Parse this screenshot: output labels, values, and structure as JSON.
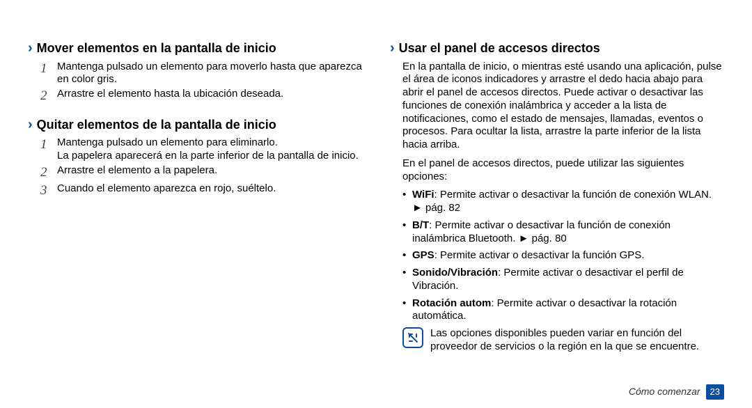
{
  "left": {
    "sec1": {
      "title": "Mover elementos en la pantalla de inicio",
      "steps": [
        "Mantenga pulsado un elemento para moverlo hasta que aparezca en color gris.",
        "Arrastre el elemento hasta la ubicación deseada."
      ]
    },
    "sec2": {
      "title": "Quitar elementos de la pantalla de inicio",
      "step1": "Mantenga pulsado un elemento para eliminarlo.",
      "step1b": "La papelera aparecerá en la parte inferior de la pantalla de inicio.",
      "step2": "Arrastre el elemento a la papelera.",
      "step3": "Cuando el elemento aparezca en rojo, suéltelo."
    }
  },
  "right": {
    "sec": {
      "title": "Usar el panel de accesos directos",
      "para1": "En la pantalla de inicio, o mientras esté usando una aplicación, pulse el área de iconos indicadores y arrastre el dedo hacia abajo para abrir el panel de accesos directos. Puede activar o desactivar las funciones de conexión inalámbrica y acceder a la lista de notificaciones, como el estado de mensajes, llamadas, eventos o procesos. Para ocultar la lista, arrastre la parte inferior de la lista hacia arriba.",
      "para2": "En el panel de accesos directos, puede utilizar las siguientes opciones:",
      "bullets": [
        {
          "bold": "WiFi",
          "rest": ": Permite activar o desactivar la función de conexión WLAN. ",
          "arrow": "►",
          "ref": " pág. 82"
        },
        {
          "bold": "B/T",
          "rest": ": Permite activar o desactivar la función de conexión inalámbrica Bluetooth. ",
          "arrow": "►",
          "ref": " pág. 80"
        },
        {
          "bold": "GPS",
          "rest": ": Permite activar o desactivar la función GPS.",
          "arrow": "",
          "ref": ""
        },
        {
          "bold": "Sonido/Vibración",
          "rest": ": Permite activar o desactivar el perfil de Vibración.",
          "arrow": "",
          "ref": ""
        },
        {
          "bold": "Rotación autom",
          "rest": ": Permite activar o desactivar la rotación automática.",
          "arrow": "",
          "ref": ""
        }
      ],
      "note": "Las opciones disponibles pueden variar en función del proveedor de servicios o la región en la que se encuentre."
    }
  },
  "footer": {
    "label": "Cómo comenzar",
    "page": "23"
  },
  "nums": {
    "n1": "1",
    "n2": "2",
    "n3": "3"
  },
  "glyphs": {
    "chevron": "›"
  }
}
